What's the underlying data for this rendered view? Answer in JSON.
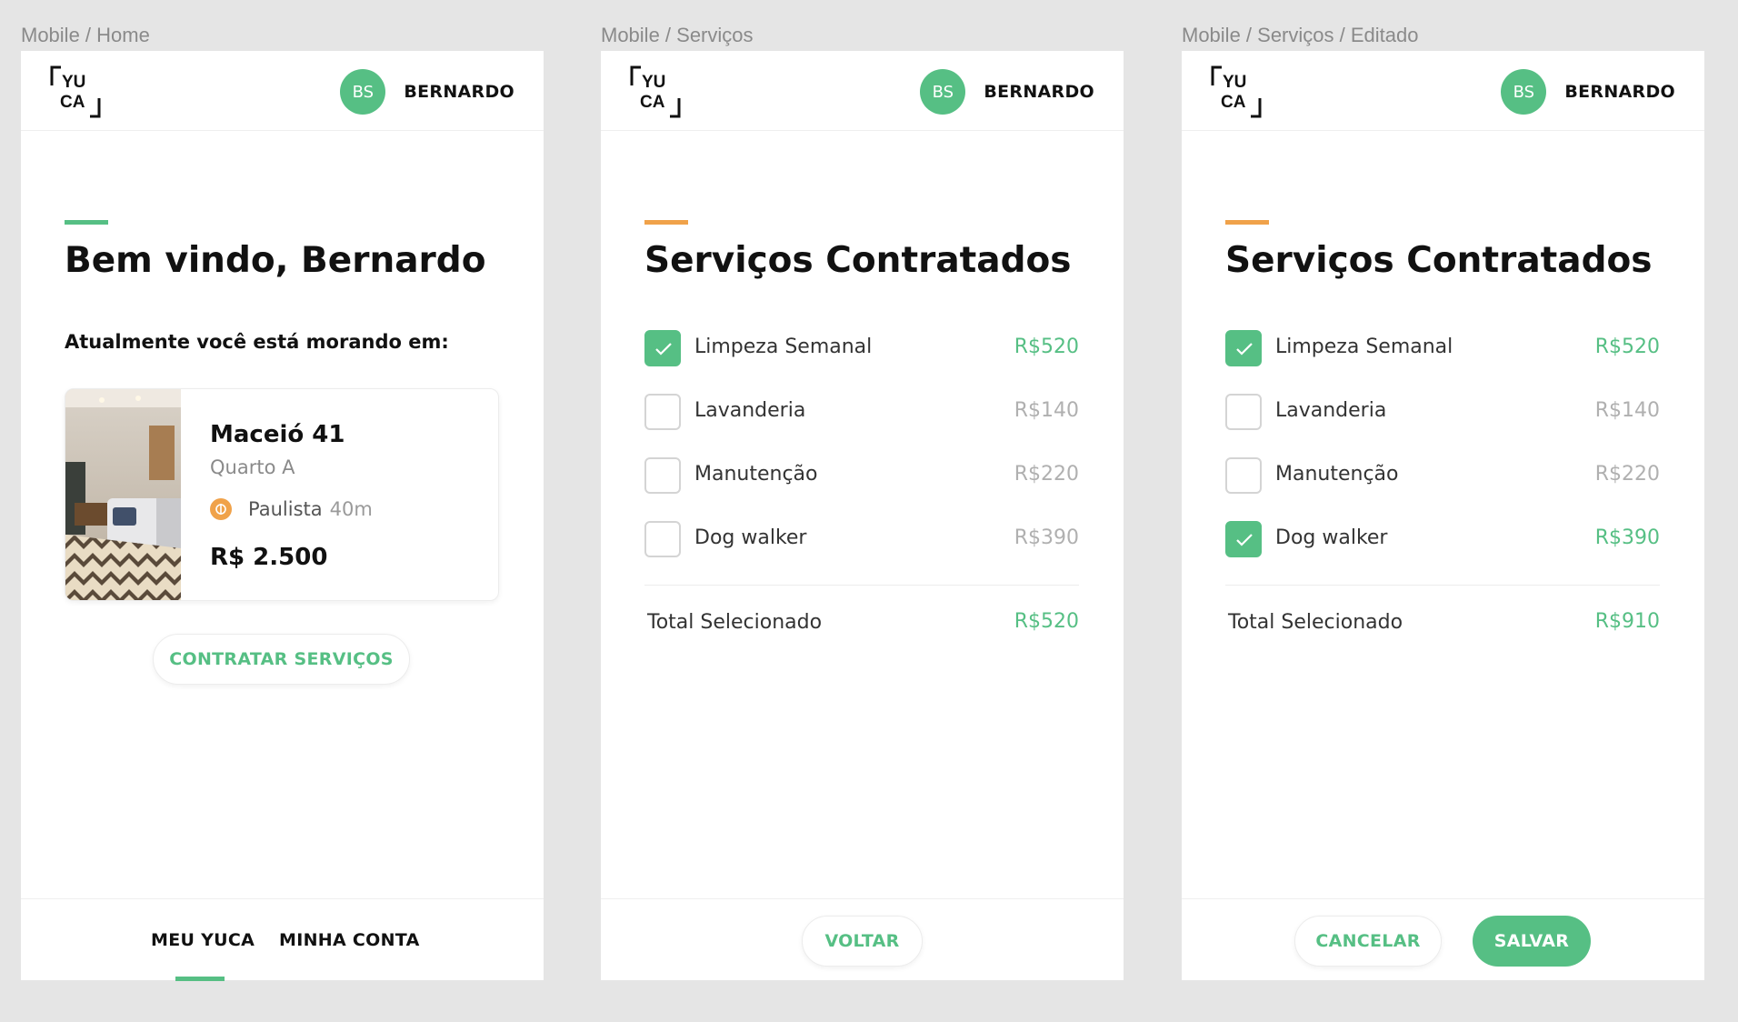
{
  "colors": {
    "green": "#56bf84",
    "orange": "#f0a24a"
  },
  "frames": [
    {
      "label": "Mobile / Home",
      "header": {
        "logo_top": "YU",
        "logo_bottom": "CA",
        "avatar_initials": "BS",
        "username": "BERNARDO"
      },
      "title": "Bem vindo, Bernardo",
      "subtitle": "Atualmente você está morando em:",
      "property": {
        "name": "Maceió 41",
        "room": "Quarto A",
        "metro_station": "Paulista",
        "metro_distance": "40m",
        "price": "R$ 2.500"
      },
      "cta_label": "CONTRATAR SERVIÇOS",
      "nav": [
        {
          "label": "MEU YUCA",
          "active": true
        },
        {
          "label": "MINHA CONTA",
          "active": false
        }
      ]
    },
    {
      "label": "Mobile / Serviços",
      "header": {
        "logo_top": "YU",
        "logo_bottom": "CA",
        "avatar_initials": "BS",
        "username": "BERNARDO"
      },
      "title": "Serviços Contratados",
      "services": [
        {
          "name": "Limpeza Semanal",
          "price": "R$520",
          "checked": true
        },
        {
          "name": "Lavanderia",
          "price": "R$140",
          "checked": false
        },
        {
          "name": "Manutenção",
          "price": "R$220",
          "checked": false
        },
        {
          "name": "Dog walker",
          "price": "R$390",
          "checked": false
        }
      ],
      "total_label": "Total Selecionado",
      "total_value": "R$520",
      "back_label": "VOLTAR"
    },
    {
      "label": "Mobile / Serviços / Editado",
      "header": {
        "logo_top": "YU",
        "logo_bottom": "CA",
        "avatar_initials": "BS",
        "username": "BERNARDO"
      },
      "title": "Serviços Contratados",
      "services": [
        {
          "name": "Limpeza Semanal",
          "price": "R$520",
          "checked": true
        },
        {
          "name": "Lavanderia",
          "price": "R$140",
          "checked": false
        },
        {
          "name": "Manutenção",
          "price": "R$220",
          "checked": false
        },
        {
          "name": "Dog walker",
          "price": "R$390",
          "checked": true
        }
      ],
      "total_label": "Total Selecionado",
      "total_value": "R$910",
      "cancel_label": "CANCELAR",
      "save_label": "SALVAR"
    }
  ]
}
